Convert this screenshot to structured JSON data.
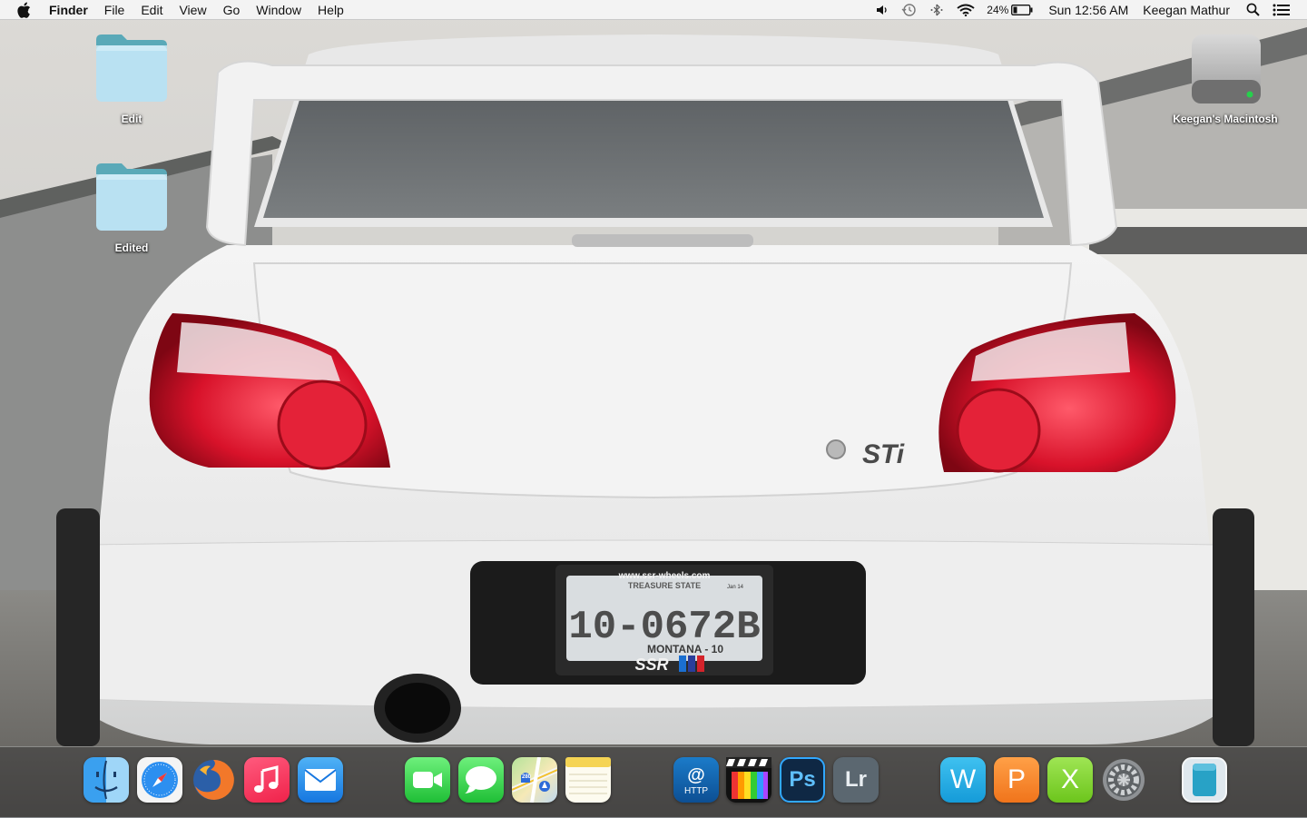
{
  "menubar": {
    "app_name": "Finder",
    "menus": [
      "File",
      "Edit",
      "View",
      "Go",
      "Window",
      "Help"
    ],
    "status": {
      "battery_percent": "24%",
      "datetime": "Sun 12:56 AM",
      "user": "Keegan Mathur"
    }
  },
  "desktop": {
    "icons": [
      {
        "label": "Edit",
        "kind": "folder-icon"
      },
      {
        "label": "Edited",
        "kind": "folder-icon"
      },
      {
        "label": "Keegan's Macintosh",
        "kind": "hard-drive-icon"
      }
    ]
  },
  "wallpaper": {
    "plate_frame_top": "www.ssr-wheels.com",
    "plate_state_line": "TREASURE STATE",
    "plate_number": "10-0672B",
    "plate_bottom": "MONTANA - 10",
    "plate_sticker": "Jan 14",
    "frame_brand": "SSR",
    "badge": "STi"
  },
  "dock": {
    "items": [
      {
        "name": "Finder",
        "icon": "finder-icon"
      },
      {
        "name": "Safari",
        "icon": "safari-icon"
      },
      {
        "name": "Firefox",
        "icon": "firefox-icon"
      },
      {
        "name": "iTunes",
        "icon": "itunes-icon"
      },
      {
        "name": "Mail",
        "icon": "mail-icon"
      },
      {
        "name": "FaceTime",
        "icon": "facetime-icon"
      },
      {
        "name": "Messages",
        "icon": "messages-icon"
      },
      {
        "name": "Maps",
        "icon": "maps-icon",
        "sign": "280"
      },
      {
        "name": "Notes",
        "icon": "notes-icon"
      },
      {
        "name": "HTTP",
        "icon": "http-client-icon",
        "text": "HTTP"
      },
      {
        "name": "Final Cut Pro",
        "icon": "final-cut-icon"
      },
      {
        "name": "Photoshop",
        "icon": "photoshop-icon",
        "text": "Ps"
      },
      {
        "name": "Lightroom",
        "icon": "lightroom-icon",
        "text": "Lr"
      },
      {
        "name": "Word",
        "icon": "word-icon",
        "text": "W"
      },
      {
        "name": "PowerPoint",
        "icon": "powerpoint-icon",
        "text": "P"
      },
      {
        "name": "Excel",
        "icon": "excel-icon",
        "text": "X"
      },
      {
        "name": "System Preferences",
        "icon": "system-preferences-icon"
      },
      {
        "name": "Downloads",
        "icon": "downloads-stack-icon"
      }
    ]
  },
  "colors": {
    "menubar_bg": "#f4f4f4",
    "folder_tab": "#5aa9b8",
    "folder_body": "#b9e1f2",
    "drive_light": "#26d04c",
    "taillight": "#d61a2c"
  }
}
